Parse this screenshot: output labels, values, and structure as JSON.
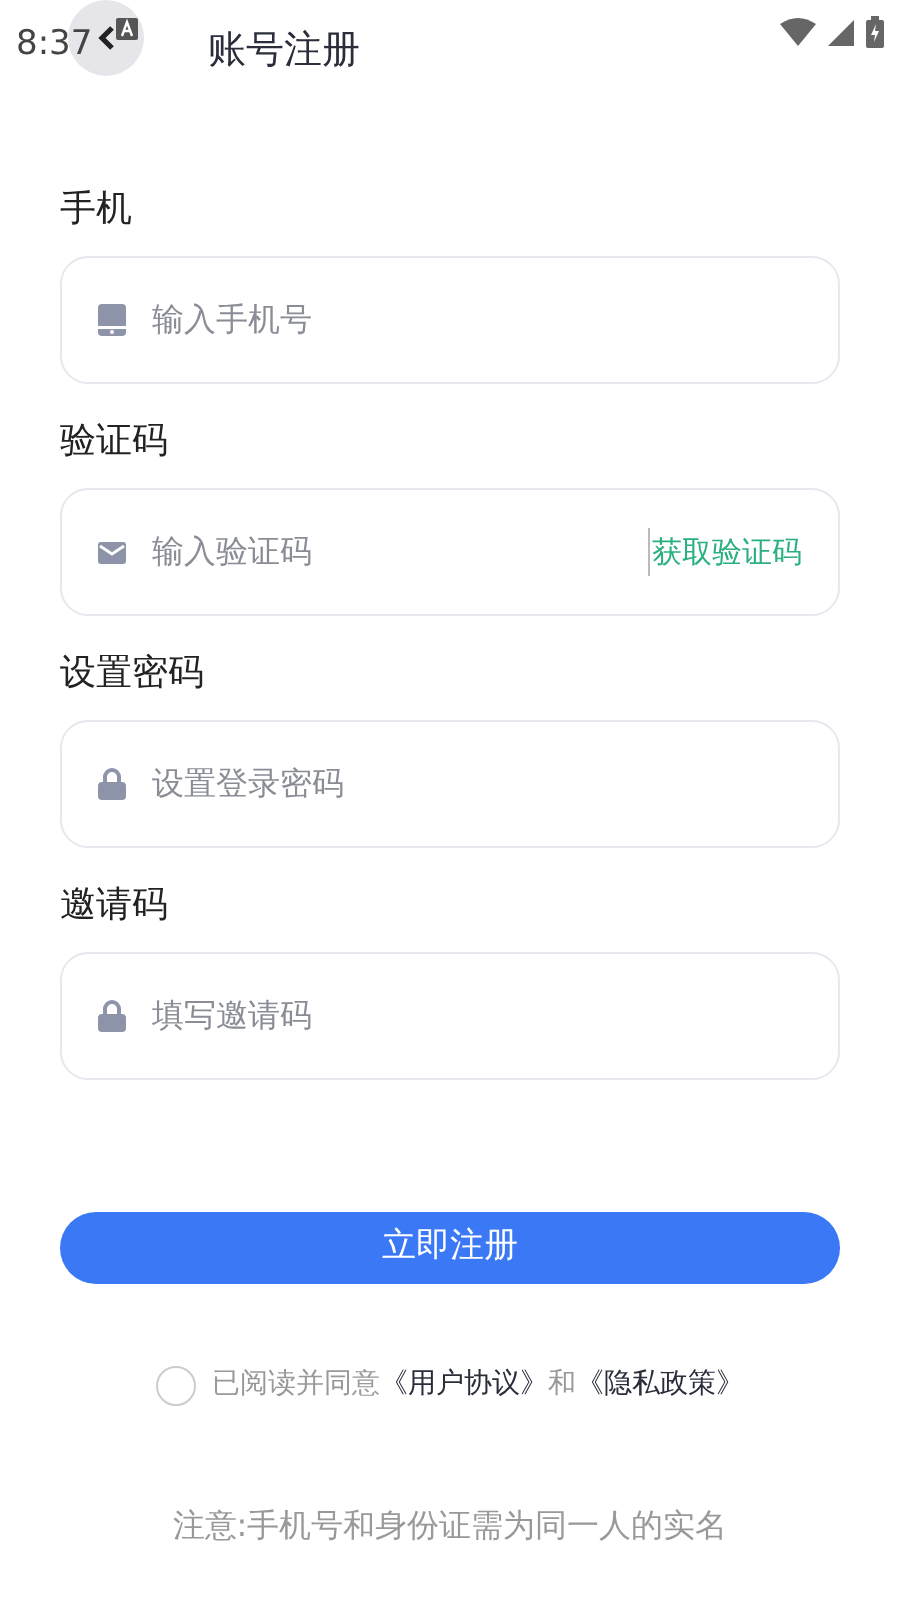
{
  "status_bar": {
    "time": "8:37"
  },
  "header": {
    "title": "账号注册"
  },
  "fields": [
    {
      "kind": "phone",
      "label": "手机",
      "placeholder": "输入手机号"
    },
    {
      "kind": "code",
      "label": "验证码",
      "placeholder": "输入验证码",
      "action": "获取验证码"
    },
    {
      "kind": "lock",
      "label": "设置密码",
      "placeholder": "设置登录密码"
    },
    {
      "kind": "lock",
      "label": "邀请码",
      "placeholder": "填写邀请码"
    }
  ],
  "submit": "立即注册",
  "agreement": {
    "checked": false,
    "prefix": "已阅读并同意",
    "links": [
      "《用户协议》",
      "《隐私政策》"
    ],
    "joiner": "和"
  },
  "note": "注意:手机号和身份证需为同一人的实名"
}
